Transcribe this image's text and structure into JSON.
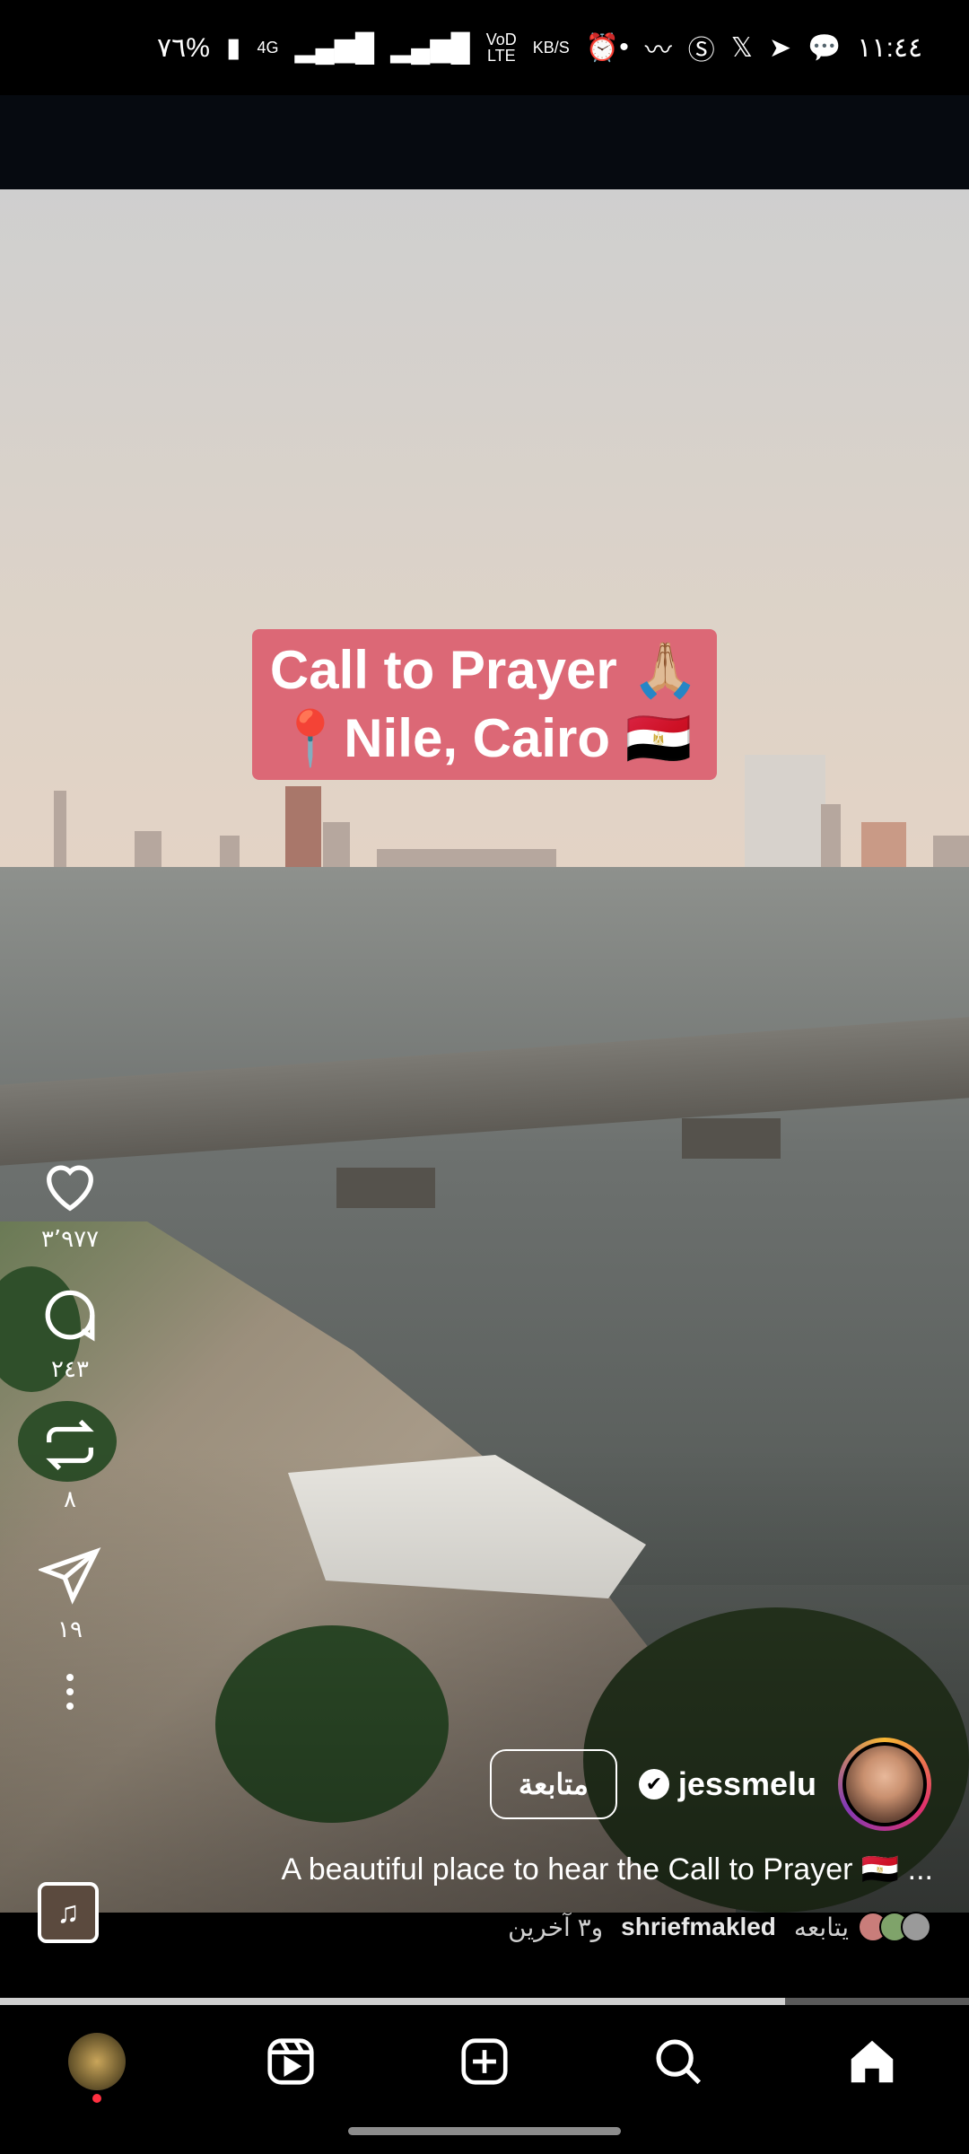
{
  "status_bar": {
    "battery": "٧٦%",
    "network": "4G",
    "volte": "VoD LTE",
    "speed_unit": "KB/S",
    "time": "١١:٤٤"
  },
  "video": {
    "title_line1": "Call to Prayer 🙏🏼",
    "title_line2": "📍Nile, Cairo 🇪🇬",
    "progress_fraction": 0.81
  },
  "actions": {
    "likes": "٣٬٩٧٧",
    "comments": "٢٤٣",
    "reposts": "٨",
    "shares": "١٩"
  },
  "user": {
    "username": "jessmelu",
    "follow_label": "متابعة",
    "caption": "A beautiful place to hear the Call to Prayer 🇪🇬 ...",
    "followed_by_text": "يتابعه",
    "followed_by_user": "shriefmakled",
    "followed_by_others": "و٣ آخرين"
  },
  "nav": {
    "items": [
      "home-icon",
      "search-icon",
      "create-icon",
      "reels-icon",
      "profile-avatar"
    ]
  },
  "colors": {
    "title_card": "#dc6876",
    "notification_dot": "#ff3040"
  }
}
